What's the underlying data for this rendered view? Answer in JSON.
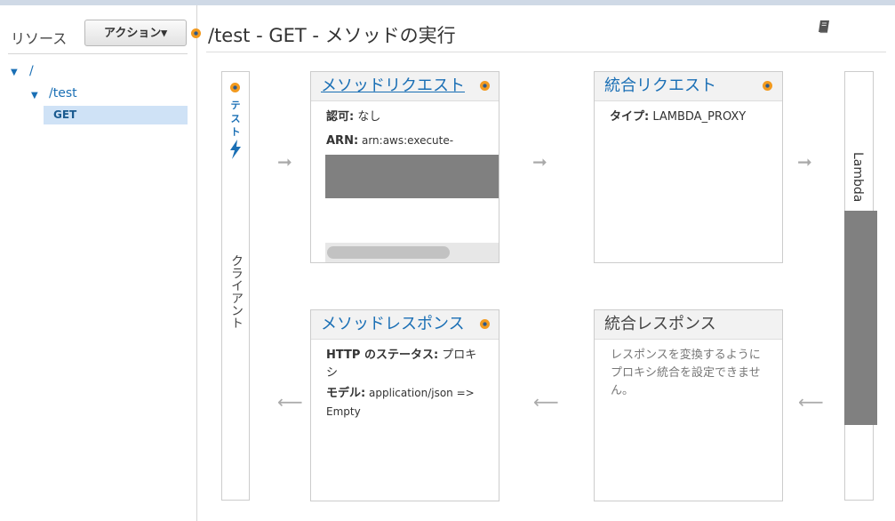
{
  "sidebar": {
    "resources_label": "リソース",
    "actions_button": "アクション▾",
    "tree": {
      "root": "/",
      "child": "/test",
      "method": "GET"
    }
  },
  "header": {
    "title": "/test - GET - メソッドの実行"
  },
  "client": {
    "test_label": "テスト",
    "column_label": "クライアント"
  },
  "method_request": {
    "title": "メソッドリクエスト",
    "auth_key": "認可:",
    "auth_value": " なし",
    "arn_key": "ARN:",
    "arn_value": " arn:aws:execute-"
  },
  "integration_request": {
    "title": "統合リクエスト",
    "type_key": "タイプ:",
    "type_value": " LAMBDA_PROXY"
  },
  "method_response": {
    "title": "メソッドレスポンス",
    "status_key": "HTTP のステータス:",
    "status_value": " プロキシ",
    "model_key": "モデル:",
    "model_value": " application/json => Empty"
  },
  "integration_response": {
    "title": "統合レスポンス",
    "note": "レスポンスを変換するようにプロキシ統合を設定できません。"
  },
  "lambda": {
    "label": "Lambda"
  },
  "arrows": {
    "right": "➞",
    "left": "⟵"
  },
  "colors": {
    "link": "#1a6fb5",
    "selected_row": "#cfe2f6",
    "redaction": "#808080",
    "badge_orange": "#f29a1f"
  },
  "icons": [
    "book-icon",
    "lightning-icon",
    "badge-dot-icon",
    "caret-down-icon"
  ]
}
